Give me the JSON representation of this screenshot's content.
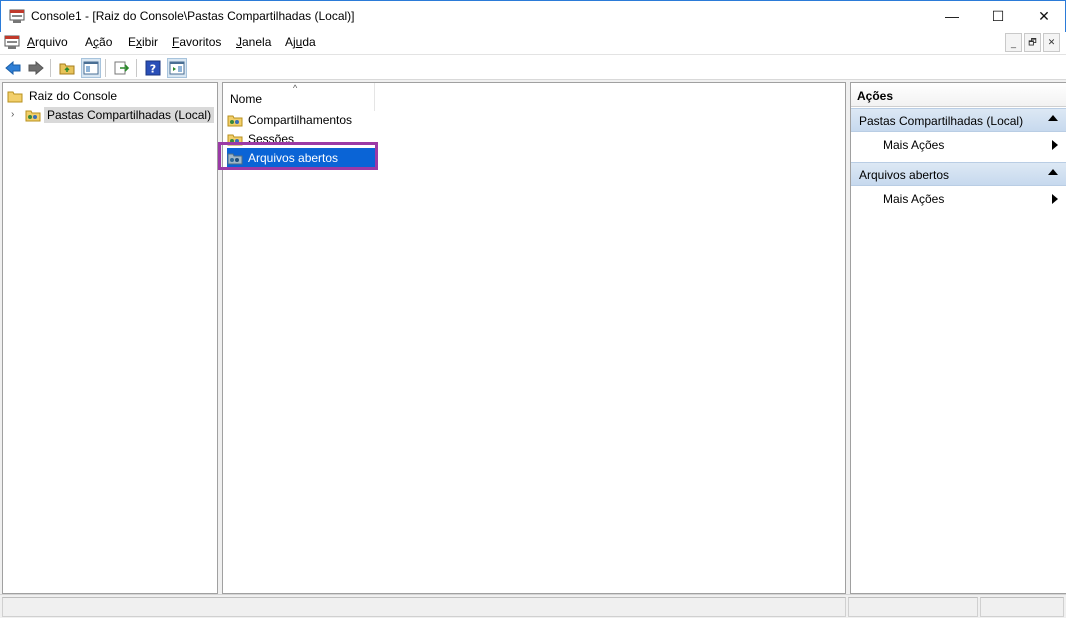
{
  "window": {
    "title": "Console1 - [Raiz do Console\\Pastas Compartilhadas (Local)]",
    "minimize": "—",
    "maximize": "☐",
    "close": "✕"
  },
  "menu": {
    "items": [
      {
        "pre": "",
        "key": "A",
        "post": "rquivo"
      },
      {
        "pre": "A",
        "key": "ç",
        "post": "ão"
      },
      {
        "pre": "E",
        "key": "x",
        "post": "ibir"
      },
      {
        "pre": "",
        "key": "F",
        "post": "avoritos"
      },
      {
        "pre": "",
        "key": "J",
        "post": "anela"
      },
      {
        "pre": "Aj",
        "key": "u",
        "post": "da"
      }
    ],
    "mdi_minimize": "_",
    "mdi_restore": "🗗",
    "mdi_close": "✕"
  },
  "tree": {
    "root_label": "Raiz do Console",
    "child_label": "Pastas Compartilhadas (Local)",
    "expander": "›"
  },
  "list": {
    "column_header": "Nome",
    "sort_indicator": "^",
    "items": [
      {
        "label": "Compartilhamentos"
      },
      {
        "label": "Sessões"
      },
      {
        "label": "Arquivos abertos"
      }
    ]
  },
  "actions": {
    "header": "Ações",
    "sections": [
      {
        "title": "Pastas Compartilhadas (Local)",
        "item": "Mais Ações"
      },
      {
        "title": "Arquivos abertos",
        "item": "Mais Ações"
      }
    ]
  },
  "colors": {
    "selection": "#0a64d6",
    "highlight_box": "#9b3aa6",
    "section_header": "#c7d9ee"
  }
}
